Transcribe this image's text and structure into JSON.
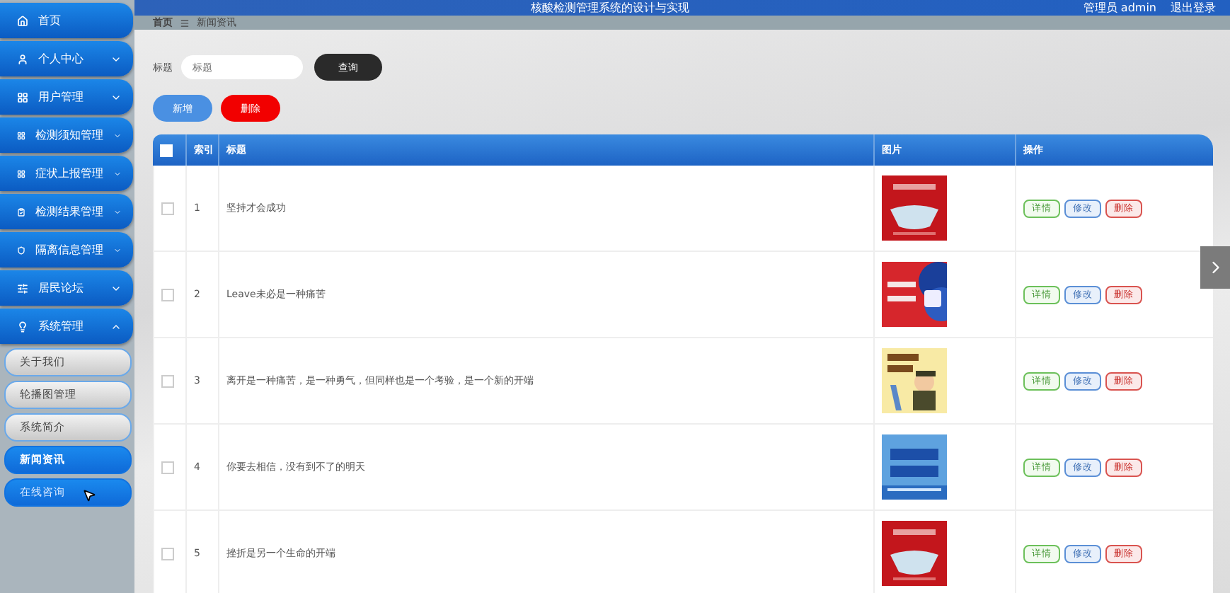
{
  "header": {
    "title": "核酸检测管理系统的设计与实现",
    "user": "管理员 admin",
    "logout": "退出登录"
  },
  "sidebar": {
    "items": [
      {
        "label": "首页"
      },
      {
        "label": "个人中心",
        "expanded": false
      },
      {
        "label": "用户管理",
        "expanded": false
      },
      {
        "label": "检测须知管理",
        "expanded": false
      },
      {
        "label": "症状上报管理",
        "expanded": false
      },
      {
        "label": "检测结果管理",
        "expanded": false
      },
      {
        "label": "隔离信息管理",
        "expanded": false
      },
      {
        "label": "居民论坛",
        "expanded": false
      },
      {
        "label": "系统管理",
        "expanded": true,
        "children": [
          {
            "label": "关于我们",
            "selected": false,
            "hovered": false
          },
          {
            "label": "轮播图管理",
            "selected": false,
            "hovered": false
          },
          {
            "label": "系统简介",
            "selected": false,
            "hovered": false
          },
          {
            "label": "新闻资讯",
            "selected": true,
            "hovered": false
          },
          {
            "label": "在线咨询",
            "selected": false,
            "hovered": true
          }
        ]
      }
    ]
  },
  "breadcrumb": [
    "首页",
    "新闻资讯"
  ],
  "search": {
    "label": "标题",
    "placeholder": "标题",
    "button": "查询"
  },
  "actions": [
    {
      "label": "新增",
      "kind": "add"
    },
    {
      "label": "删除",
      "kind": "delete"
    }
  ],
  "table": {
    "columns": [
      "索引",
      "标题",
      "图片",
      "操作"
    ],
    "all_checked": false,
    "rows": [
      {
        "checked": false,
        "index": "1",
        "title": "坚持才会成功",
        "actions": [
          {
            "label": "详情",
            "kind": "detail"
          },
          {
            "label": "修改",
            "kind": "edit"
          },
          {
            "label": "删除",
            "kind": "delete"
          }
        ]
      },
      {
        "checked": false,
        "index": "2",
        "title": "Leave未必是一种痛苦",
        "actions": [
          {
            "label": "详情",
            "kind": "detail"
          },
          {
            "label": "修改",
            "kind": "edit"
          },
          {
            "label": "删除",
            "kind": "delete"
          }
        ]
      },
      {
        "checked": false,
        "index": "3",
        "title": "离开是一种痛苦，是一种勇气，但同样也是一个考验，是一个新的开端",
        "actions": [
          {
            "label": "详情",
            "kind": "detail"
          },
          {
            "label": "修改",
            "kind": "edit"
          },
          {
            "label": "删除",
            "kind": "delete"
          }
        ]
      },
      {
        "checked": false,
        "index": "4",
        "title": "你要去相信，没有到不了的明天",
        "actions": [
          {
            "label": "详情",
            "kind": "detail"
          },
          {
            "label": "修改",
            "kind": "edit"
          },
          {
            "label": "删除",
            "kind": "delete"
          }
        ]
      },
      {
        "checked": false,
        "index": "5",
        "title": "挫折是另一个生命的开端",
        "actions": [
          {
            "label": "详情",
            "kind": "detail"
          },
          {
            "label": "修改",
            "kind": "edit"
          },
          {
            "label": "删除",
            "kind": "delete"
          }
        ]
      }
    ]
  }
}
